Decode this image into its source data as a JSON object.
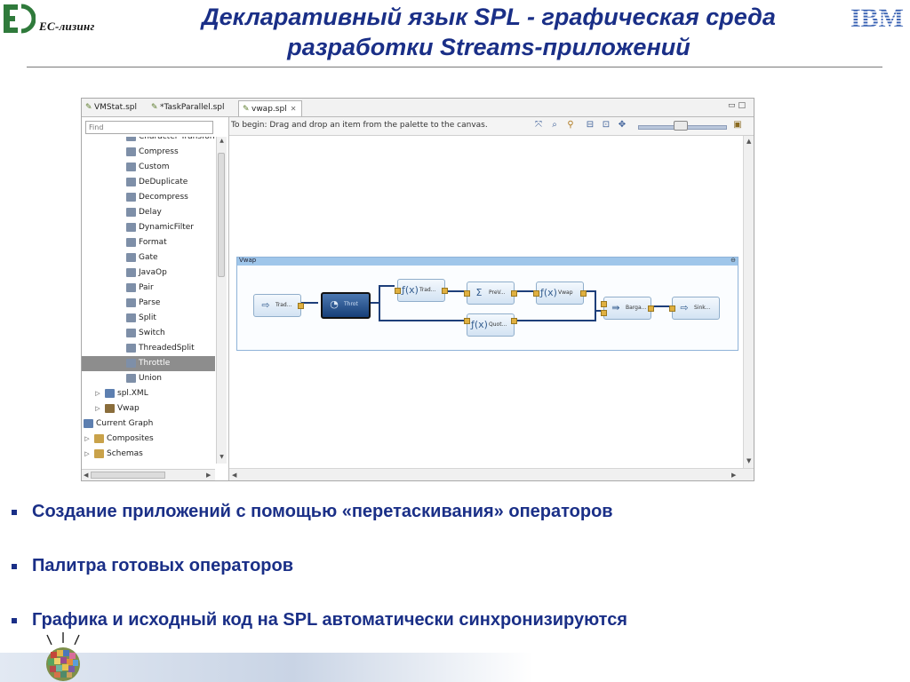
{
  "header": {
    "logo_left": "ЕС-лизинг",
    "logo_right": "IBM",
    "title_line1": "Декларативный язык SPL - графическая среда",
    "title_line2": "разработки Streams-приложений"
  },
  "editor": {
    "tabs": [
      {
        "label": "VMStat.spl",
        "active": false
      },
      {
        "label": "*TaskParallel.spl",
        "active": false
      },
      {
        "label": "vwap.spl",
        "active": true
      }
    ],
    "palette": {
      "find_placeholder": "Find",
      "items": [
        {
          "label": "Character Transform",
          "icon": "operator-icon"
        },
        {
          "label": "Compress",
          "icon": "operator-icon"
        },
        {
          "label": "Custom",
          "icon": "operator-icon"
        },
        {
          "label": "DeDuplicate",
          "icon": "operator-icon"
        },
        {
          "label": "Decompress",
          "icon": "operator-icon"
        },
        {
          "label": "Delay",
          "icon": "operator-icon"
        },
        {
          "label": "DynamicFilter",
          "icon": "operator-icon"
        },
        {
          "label": "Format",
          "icon": "operator-icon"
        },
        {
          "label": "Gate",
          "icon": "operator-icon"
        },
        {
          "label": "JavaOp",
          "icon": "operator-icon"
        },
        {
          "label": "Pair",
          "icon": "operator-icon"
        },
        {
          "label": "Parse",
          "icon": "operator-icon"
        },
        {
          "label": "Split",
          "icon": "operator-icon"
        },
        {
          "label": "Switch",
          "icon": "operator-icon"
        },
        {
          "label": "ThreadedSplit",
          "icon": "operator-icon"
        },
        {
          "label": "Throttle",
          "icon": "operator-icon",
          "selected": true
        },
        {
          "label": "Union",
          "icon": "operator-icon"
        },
        {
          "label": "spl.XML",
          "icon": "namespace-icon",
          "collapsed": true
        },
        {
          "label": "Vwap",
          "icon": "composite-icon",
          "collapsed": true
        },
        {
          "label": "Current Graph",
          "icon": "graph-icon",
          "expanded": true
        },
        {
          "label": "Composites",
          "icon": "folder-icon",
          "collapsed": true
        },
        {
          "label": "Schemas",
          "icon": "folder-icon",
          "collapsed": true
        }
      ]
    },
    "toolbar": {
      "hint": "To begin:  Drag and drop an item from  the palette to the canvas."
    },
    "graph": {
      "composite_name": "Vwap",
      "operators": [
        {
          "id": "trade-source",
          "label": "Trad...",
          "icon": "arrow-right-icon"
        },
        {
          "id": "throttle",
          "label": "Throt",
          "icon": "gauge-icon",
          "selected": true
        },
        {
          "id": "trade-filter",
          "label": "Trad...",
          "icon": "function-icon"
        },
        {
          "id": "quote-filter",
          "label": "Quot...",
          "icon": "function-icon"
        },
        {
          "id": "prevwap",
          "label": "PreV...",
          "icon": "sum-icon"
        },
        {
          "id": "vwap",
          "label": "Vwap",
          "icon": "function-icon"
        },
        {
          "id": "bargain",
          "label": "Barga...",
          "icon": "join-icon"
        },
        {
          "id": "sink",
          "label": "Sink...",
          "icon": "arrow-right-icon"
        }
      ]
    }
  },
  "bullets": [
    "Создание приложений с помощью «перетаскивания» операторов",
    "Палитра готовых операторов",
    "Графика и исходный код на SPL автоматически синхронизируются"
  ],
  "colors": {
    "title_blue": "#1a2f87",
    "ec_logo_green": "#2f7a3b",
    "ibm_blue": "#3c64b4",
    "selected_operator": "#1f4a84"
  }
}
